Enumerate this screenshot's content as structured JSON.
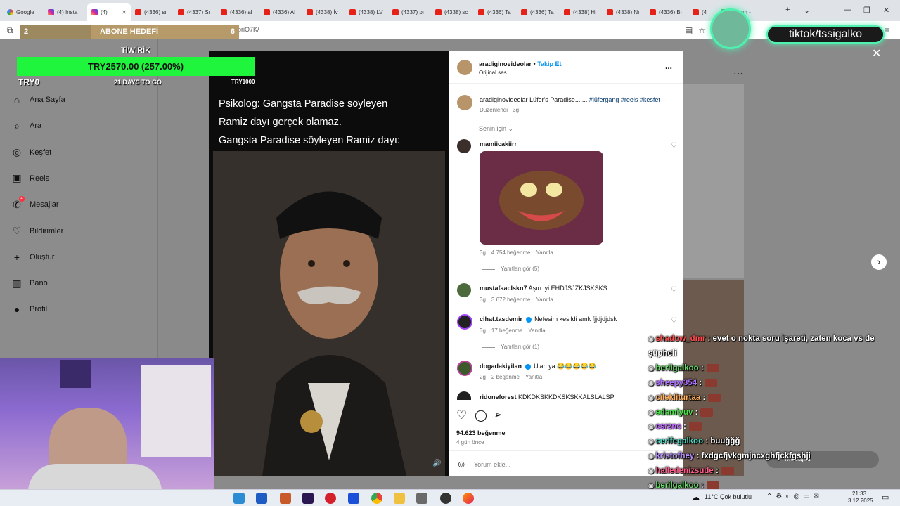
{
  "browser": {
    "tabs": [
      {
        "label": "Google",
        "icon": "google-icon"
      },
      {
        "label": "(4) Insta",
        "icon": "instagram-icon"
      },
      {
        "label": "(4)",
        "icon": "instagram-icon",
        "active": true
      },
      {
        "label": "(4336) sı",
        "icon": "youtube-icon"
      },
      {
        "label": "(4337) Sı",
        "icon": "youtube-icon"
      },
      {
        "label": "(4336) al",
        "icon": "youtube-icon"
      },
      {
        "label": "(4336) Al",
        "icon": "youtube-icon"
      },
      {
        "label": "(4338) İv",
        "icon": "youtube-icon"
      },
      {
        "label": "(4338) LV",
        "icon": "youtube-icon"
      },
      {
        "label": "(4337) pı",
        "icon": "youtube-icon"
      },
      {
        "label": "(4338) sc",
        "icon": "youtube-icon"
      },
      {
        "label": "(4336) Ta",
        "icon": "youtube-icon"
      },
      {
        "label": "(4336) Ta",
        "icon": "youtube-icon"
      },
      {
        "label": "(4338) Hı",
        "icon": "youtube-icon"
      },
      {
        "label": "(4338) Nı",
        "icon": "youtube-icon"
      },
      {
        "label": "(4336) Bı",
        "icon": "youtube-icon"
      },
      {
        "label": "(4",
        "icon": "youtube-icon"
      },
      {
        "label": "Boşam -",
        "icon": "green-icon"
      }
    ],
    "url": "www.instagram.com/p/DR ... briO7K/",
    "new_tab": "+"
  },
  "overlay": {
    "subgoal_count": "2",
    "subgoal_label": "ABONE HEDEFİ",
    "subgoal_target": "6",
    "tiwirik_title": "TİWİRİK",
    "tiwirik_amount": "TRY2570.00 (257.00%)",
    "tiwirik_left": "TRY0",
    "tiwirik_days": "21 DAYS TO GO",
    "tiwirik_goal": "TRY1000",
    "tiktok_handle": "tiktok/tssigalko"
  },
  "sidebar": {
    "items": [
      {
        "label": "Ana Sayfa",
        "icon": "home-icon"
      },
      {
        "label": "Ara",
        "icon": "search-icon"
      },
      {
        "label": "Keşfet",
        "icon": "compass-icon"
      },
      {
        "label": "Reels",
        "icon": "reels-icon"
      },
      {
        "label": "Mesajlar",
        "icon": "messenger-icon",
        "badge": "4"
      },
      {
        "label": "Bildirimler",
        "icon": "heart-icon"
      },
      {
        "label": "Oluştur",
        "icon": "plus-icon"
      },
      {
        "label": "Pano",
        "icon": "dashboard-icon"
      },
      {
        "label": "Profil",
        "icon": "profile-icon"
      }
    ]
  },
  "post": {
    "caption_lines": [
      "Psikolog: Gangsta Paradise söyleyen",
      "Ramiz dayı gerçek olamaz.",
      "Gangsta Paradise söyleyen Ramiz dayı:"
    ],
    "author": "aradiginovideolar",
    "follow_label": "Takip Et",
    "separator": "•",
    "audio": "Orijinal ses",
    "more_icon": "...",
    "description_user": "aradiginovideolar",
    "description_text": "Lüfer's Paradise.......",
    "hashtags": "#lüfergang #reels #kesfet",
    "edited": "Düzenlendi · 3g",
    "sort_label": "Senin için",
    "likes": "94.623 beğenme",
    "posted": "4 gün önce",
    "comment_placeholder": "Yorum ekle..."
  },
  "comments": [
    {
      "user": "mamiicakiirr",
      "text": "",
      "time": "3g",
      "likes": "4.754 beğenme",
      "reply": "Yanıtla",
      "replies": "Yanıtları gör (5)",
      "has_gif": true
    },
    {
      "user": "mustafaaclskn7",
      "text": "Aşırı iyi EHDJSJZKJSKSKS",
      "time": "3g",
      "likes": "3.672 beğenme",
      "reply": "Yanıtla"
    },
    {
      "user": "cihat.tasdemir",
      "text": "Nefesim kesildi amk fjjdjdjdsk",
      "time": "3g",
      "likes": "17 beğenme",
      "reply": "Yanıtla",
      "replies": "Yanıtları gör (1)",
      "verified": true
    },
    {
      "user": "dogadakiyilan",
      "text": "Ulan ya 😂😂😂😂😂",
      "time": "2g",
      "likes": "2 beğenme",
      "reply": "Yanıtla",
      "verified": true
    },
    {
      "user": "ridoneforest",
      "text": "KDKDKSKKDKSKSKKALSLALSP",
      "time": "",
      "likes": "",
      "reply": ""
    }
  ],
  "chat": [
    {
      "user": "shadow_dmr",
      "text": ": evet o nokta soru işareti, zaten koca vs de",
      "color": "#ff4d4d"
    },
    {
      "user": "",
      "text": "şüpheli",
      "color": "#ffffff"
    },
    {
      "user": "berilgalkoo",
      "text": ":",
      "color": "#6be36b",
      "emote": true
    },
    {
      "user": "sheepy354",
      "text": ":",
      "color": "#b070ff",
      "emote": true
    },
    {
      "user": "cilekliturtaa",
      "text": ":",
      "color": "#ffb060",
      "emote": true
    },
    {
      "user": "edamiyuv",
      "text": ":",
      "color": "#4dde4d",
      "emote": true
    },
    {
      "user": "csrznc",
      "text": ":",
      "color": "#c06bff",
      "emote": true
    },
    {
      "user": "serifegalkoo",
      "text": ": buuğğğ",
      "color": "#4bdcc5"
    },
    {
      "user": "kristofhey",
      "text": ": fxdgcfjvkgmjncxghfjckfgshji",
      "color": "#b890ff"
    },
    {
      "user": "halledenizsude",
      "text": ":",
      "color": "#ff5b8a",
      "emote": true
    },
    {
      "user": "berilgalkoo",
      "text": ":",
      "color": "#6be36b",
      "emote": true
    }
  ],
  "background": {
    "messages_label": "Mesajlar"
  },
  "taskbar": {
    "weather": "11°C  Çok bulutlu",
    "time": "21:33",
    "date": "3.12.2025"
  }
}
